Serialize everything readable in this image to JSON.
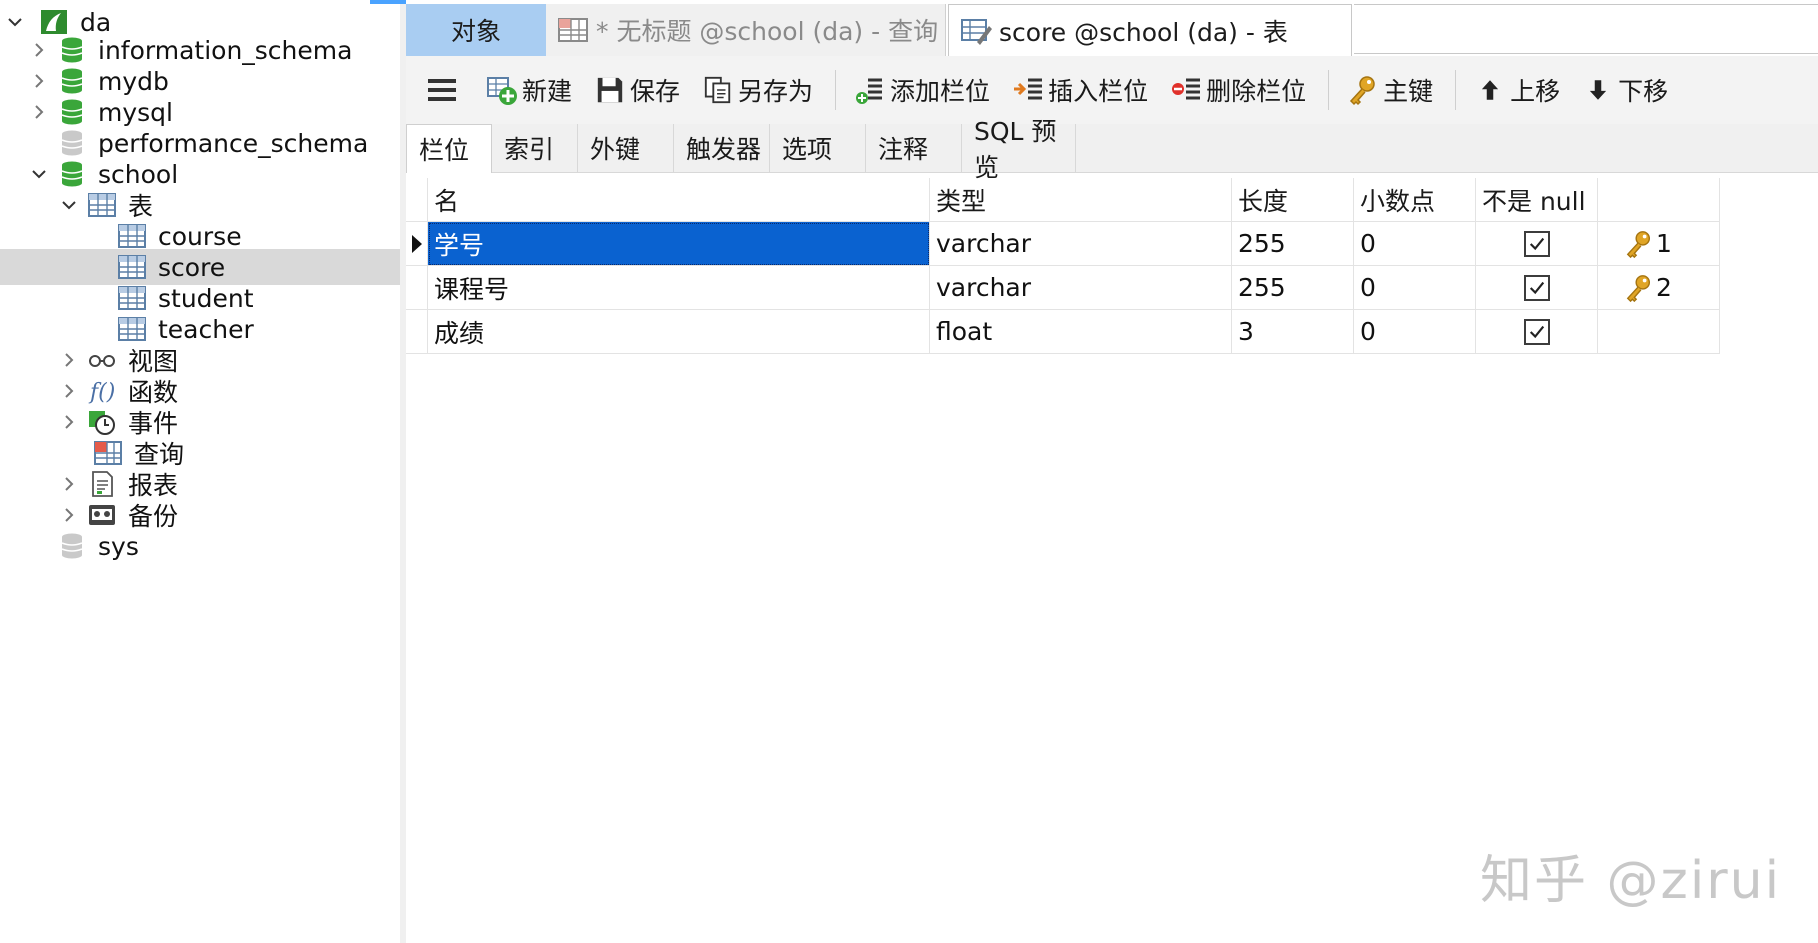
{
  "sidebar": {
    "items": [
      {
        "label": "da",
        "icon": "connection-icon",
        "expanded": true
      },
      {
        "label": "information_schema",
        "icon": "database-icon"
      },
      {
        "label": "mydb",
        "icon": "database-icon"
      },
      {
        "label": "mysql",
        "icon": "database-icon"
      },
      {
        "label": "performance_schema",
        "icon": "database-icon"
      },
      {
        "label": "school",
        "icon": "database-icon",
        "expanded": true
      },
      {
        "label": "表",
        "icon": "tables-folder-icon",
        "expanded": true
      },
      {
        "label": "course",
        "icon": "table-icon"
      },
      {
        "label": "score",
        "icon": "table-icon",
        "selected": true
      },
      {
        "label": "student",
        "icon": "table-icon"
      },
      {
        "label": "teacher",
        "icon": "table-icon"
      },
      {
        "label": "视图",
        "icon": "view-icon"
      },
      {
        "label": "函数",
        "icon": "function-icon"
      },
      {
        "label": "事件",
        "icon": "event-icon"
      },
      {
        "label": "查询",
        "icon": "query-icon"
      },
      {
        "label": "报表",
        "icon": "report-icon"
      },
      {
        "label": "备份",
        "icon": "backup-icon"
      },
      {
        "label": "sys",
        "icon": "database-icon"
      }
    ]
  },
  "tabs": {
    "objects": "对象",
    "query": "* 无标题 @school (da) - 查询",
    "score": "score @school (da) - 表"
  },
  "toolbar": {
    "new": "新建",
    "save": "保存",
    "save_as": "另存为",
    "add_field": "添加栏位",
    "insert_field": "插入栏位",
    "delete_field": "删除栏位",
    "primary_key": "主键",
    "move_up": "上移",
    "move_down": "下移"
  },
  "subtabs": [
    "栏位",
    "索引",
    "外键",
    "触发器",
    "选项",
    "注释",
    "SQL 预览"
  ],
  "grid": {
    "headers": [
      "名",
      "类型",
      "长度",
      "小数点",
      "不是 null",
      ""
    ],
    "rows": [
      {
        "name": "学号",
        "type": "varchar",
        "length": "255",
        "decimals": "0",
        "not_null": true,
        "key": "1"
      },
      {
        "name": "课程号",
        "type": "varchar",
        "length": "255",
        "decimals": "0",
        "not_null": true,
        "key": "2"
      },
      {
        "name": "成绩",
        "type": "float",
        "length": "3",
        "decimals": "0",
        "not_null": true,
        "key": ""
      }
    ]
  },
  "watermark": "知乎 @zirui",
  "colors": {
    "accent_tab": "#a9cdf2",
    "selection": "#0a62d0",
    "db_green": "#3aa63a",
    "key_gold": "#e0a526"
  }
}
